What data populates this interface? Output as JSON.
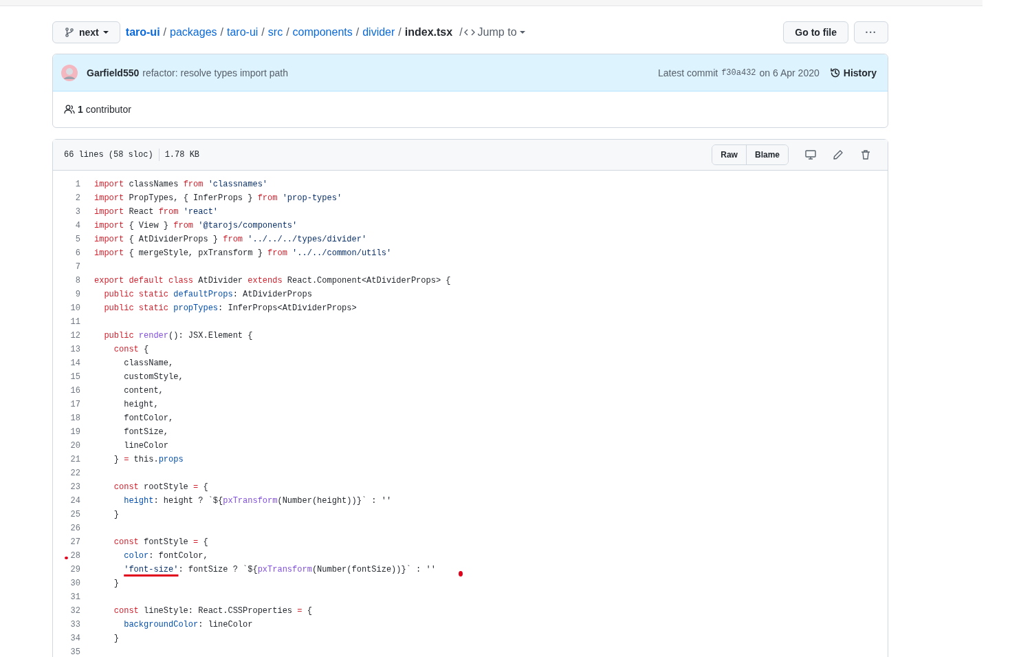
{
  "branch": {
    "label": "next"
  },
  "breadcrumb": [
    {
      "label": "taro-ui",
      "kind": "repo"
    },
    {
      "sep": "/",
      "label": "packages",
      "kind": "dir"
    },
    {
      "sep": "/",
      "label": "taro-ui",
      "kind": "dir"
    },
    {
      "sep": "/",
      "label": "src",
      "kind": "dir"
    },
    {
      "sep": "/",
      "label": "components",
      "kind": "dir"
    },
    {
      "sep": "/",
      "label": "divider",
      "kind": "dir"
    },
    {
      "sep": "/",
      "label": "index.tsx",
      "kind": "file"
    }
  ],
  "jump_sep": "/",
  "jump_to": "Jump to",
  "go_to_file": "Go to file",
  "more": "···",
  "commit": {
    "author": "Garfield550",
    "message": "refactor: resolve types import path",
    "latest_label": "Latest commit",
    "sha": "f30a432",
    "date": "on 6 Apr 2020",
    "history": "History"
  },
  "contributors": {
    "count": "1",
    "label": "contributor"
  },
  "file_info": {
    "lines": "66 lines (58 sloc)",
    "size": "1.78 KB"
  },
  "file_buttons": [
    "Raw",
    "Blame"
  ],
  "code": [
    {
      "n": "1",
      "tokens": [
        {
          "kind": "kw",
          "text": "import"
        },
        {
          "kind": "plain",
          "text": " classNames "
        },
        {
          "kind": "kw",
          "text": "from"
        },
        {
          "kind": "str",
          "text": " 'classnames'"
        }
      ]
    },
    {
      "n": "2",
      "tokens": [
        {
          "kind": "kw",
          "text": "import"
        },
        {
          "kind": "plain",
          "text": " PropTypes, { InferProps } "
        },
        {
          "kind": "kw",
          "text": "from"
        },
        {
          "kind": "str",
          "text": " 'prop-types'"
        }
      ]
    },
    {
      "n": "3",
      "tokens": [
        {
          "kind": "kw",
          "text": "import"
        },
        {
          "kind": "plain",
          "text": " React "
        },
        {
          "kind": "kw",
          "text": "from"
        },
        {
          "kind": "str",
          "text": " 'react'"
        }
      ]
    },
    {
      "n": "4",
      "tokens": [
        {
          "kind": "kw",
          "text": "import"
        },
        {
          "kind": "plain",
          "text": " { View } "
        },
        {
          "kind": "kw",
          "text": "from"
        },
        {
          "kind": "str",
          "text": " '@tarojs/components'"
        }
      ]
    },
    {
      "n": "5",
      "tokens": [
        {
          "kind": "kw",
          "text": "import"
        },
        {
          "kind": "plain",
          "text": " { AtDividerProps } "
        },
        {
          "kind": "kw",
          "text": "from"
        },
        {
          "kind": "str",
          "text": " '../../../types/divider'"
        }
      ]
    },
    {
      "n": "6",
      "tokens": [
        {
          "kind": "kw",
          "text": "import"
        },
        {
          "kind": "plain",
          "text": " { mergeStyle, pxTransform } "
        },
        {
          "kind": "kw",
          "text": "from"
        },
        {
          "kind": "str",
          "text": " '../../common/utils'"
        }
      ]
    },
    {
      "n": "7"
    },
    {
      "n": "8",
      "tokens": [
        {
          "kind": "kw",
          "text": "export default class"
        },
        {
          "kind": "plain",
          "text": " AtDivider "
        },
        {
          "kind": "kw",
          "text": "extends"
        },
        {
          "kind": "plain",
          "text": " React.Component<AtDividerProps> {"
        }
      ]
    },
    {
      "n": "9",
      "tokens": [
        {
          "kind": "kw",
          "text": "  public static"
        },
        {
          "kind": "prop",
          "text": " defaultProps"
        },
        {
          "kind": "plain",
          "text": ": AtDividerProps"
        }
      ]
    },
    {
      "n": "10",
      "tokens": [
        {
          "kind": "kw",
          "text": "  public static"
        },
        {
          "kind": "prop",
          "text": " propTypes"
        },
        {
          "kind": "plain",
          "text": ": InferProps<AtDividerProps>"
        }
      ]
    },
    {
      "n": "11"
    },
    {
      "n": "12",
      "tokens": [
        {
          "kind": "kw",
          "text": "  public"
        },
        {
          "kind": "fn",
          "text": " render"
        },
        {
          "kind": "plain",
          "text": "(): JSX.Element {"
        }
      ]
    },
    {
      "n": "13",
      "tokens": [
        {
          "kind": "kw",
          "text": "    const"
        },
        {
          "kind": "plain",
          "text": " {"
        }
      ]
    },
    {
      "n": "14",
      "tokens": [
        {
          "kind": "plain",
          "text": "      className,"
        }
      ]
    },
    {
      "n": "15",
      "tokens": [
        {
          "kind": "plain",
          "text": "      customStyle,"
        }
      ]
    },
    {
      "n": "16",
      "tokens": [
        {
          "kind": "plain",
          "text": "      content,"
        }
      ]
    },
    {
      "n": "17",
      "tokens": [
        {
          "kind": "plain",
          "text": "      height,"
        }
      ]
    },
    {
      "n": "18",
      "tokens": [
        {
          "kind": "plain",
          "text": "      fontColor,"
        }
      ]
    },
    {
      "n": "19",
      "tokens": [
        {
          "kind": "plain",
          "text": "      fontSize,"
        }
      ]
    },
    {
      "n": "20",
      "tokens": [
        {
          "kind": "plain",
          "text": "      lineColor"
        }
      ]
    },
    {
      "n": "21",
      "tokens": [
        {
          "kind": "plain",
          "text": "    } "
        },
        {
          "kind": "kw",
          "text": "="
        },
        {
          "kind": "plain",
          "text": " this."
        },
        {
          "kind": "prop",
          "text": "props"
        }
      ]
    },
    {
      "n": "22"
    },
    {
      "n": "23",
      "tokens": [
        {
          "kind": "kw",
          "text": "    const"
        },
        {
          "kind": "plain",
          "text": " rootStyle "
        },
        {
          "kind": "kw",
          "text": "="
        },
        {
          "kind": "plain",
          "text": " {"
        }
      ]
    },
    {
      "n": "24",
      "tokens": [
        {
          "kind": "prop",
          "text": "      height"
        },
        {
          "kind": "plain",
          "text": ": height ? `${"
        },
        {
          "kind": "fn",
          "text": "pxTransform"
        },
        {
          "kind": "plain",
          "text": "(Number(height))}` : ''"
        }
      ]
    },
    {
      "n": "25",
      "tokens": [
        {
          "kind": "plain",
          "text": "    }"
        }
      ]
    },
    {
      "n": "26"
    },
    {
      "n": "27",
      "tokens": [
        {
          "kind": "kw",
          "text": "    const"
        },
        {
          "kind": "plain",
          "text": " fontStyle "
        },
        {
          "kind": "kw",
          "text": "="
        },
        {
          "kind": "plain",
          "text": " {"
        }
      ]
    },
    {
      "n": "28",
      "marked": true,
      "tokens": [
        {
          "kind": "prop",
          "text": "      color"
        },
        {
          "kind": "plain",
          "text": ": fontColor,"
        }
      ]
    },
    {
      "n": "29",
      "tokens": [
        {
          "kind": "indent",
          "text": "      'font-size'",
          "underlined": true
        },
        {
          "kind": "plain",
          "text": ": fontSize ? `${"
        },
        {
          "kind": "fn",
          "text": "pxTransform"
        },
        {
          "kind": "plain",
          "text": "(Number(fontSize))}` : ''"
        }
      ]
    },
    {
      "n": "30",
      "tokens": [
        {
          "kind": "plain",
          "text": "    }"
        }
      ]
    },
    {
      "n": "31"
    },
    {
      "n": "32",
      "tokens": [
        {
          "kind": "kw",
          "text": "    const"
        },
        {
          "kind": "plain",
          "text": " lineStyle: React.CSSProperties "
        },
        {
          "kind": "kw",
          "text": "="
        },
        {
          "kind": "plain",
          "text": " {"
        }
      ]
    },
    {
      "n": "33",
      "tokens": [
        {
          "kind": "prop",
          "text": "      backgroundColor"
        },
        {
          "kind": "plain",
          "text": ": lineColor"
        }
      ]
    },
    {
      "n": "34",
      "tokens": [
        {
          "kind": "plain",
          "text": "    }"
        }
      ]
    },
    {
      "n": "35"
    }
  ]
}
